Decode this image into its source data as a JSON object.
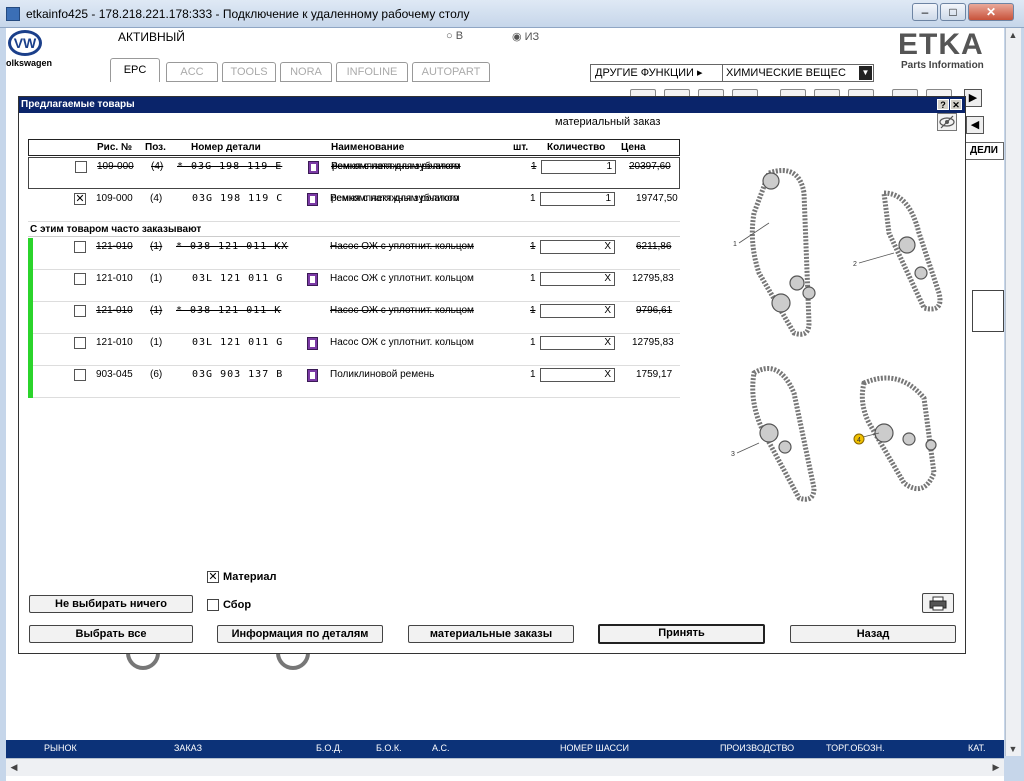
{
  "window": {
    "title": "etkainfo425 - 178.218.221.178:333 - Подключение к удаленному рабочему столу",
    "minimize": "–",
    "maximize": "□",
    "close": "✕"
  },
  "app": {
    "brand": "olkswagen",
    "vw_logo_text": "VW",
    "status": "АКТИВНЫЙ",
    "radio_b": "○ В",
    "radio_iz": "◉ ИЗ",
    "logo": "ETKA",
    "logo_sub": "Parts Information",
    "tabs": [
      "EPC",
      "ACC",
      "TOOLS",
      "NORA",
      "INFOLINE",
      "AUTOPART"
    ],
    "functions_label": "ДРУГИЕ ФУНКЦИИ ▸",
    "functions_value": "ХИМИЧЕСКИЕ ВЕЩЕС",
    "models_button": "ДЕЛИ"
  },
  "statusbar": {
    "market": "РЫНОК",
    "order": "ЗАКАЗ",
    "bod": "Б.О.Д.",
    "bok": "Б.О.К.",
    "ac": "А.С.",
    "chassis": "НОМЕР ШАССИ",
    "production": "ПРОИЗВОДСТВО",
    "trade": "ТОРГ.ОБОЗН.",
    "cat": "КАТ."
  },
  "dialog": {
    "title": "Предлагаемые товары",
    "help_btn": "?",
    "close_btn": "✕",
    "caption": "материальный заказ",
    "columns": {
      "fig": "Рис. №",
      "pos": "Поз.",
      "part": "Номер детали",
      "name": "Наименование",
      "pcs": "шт.",
      "qty": "Количество",
      "price": "Цена"
    },
    "main_rows": [
      {
        "fig": "109-000",
        "pos": "(4)",
        "part": "* 03G 198 119 E",
        "name1": "Ремкомплект для зубчатого",
        "name2": "ремня с натяжным роликом",
        "pcs": "1",
        "qty": "1",
        "price": "20397,60",
        "checked": "",
        "strike": true
      },
      {
        "fig": "109-000",
        "pos": "(4)",
        "part": "03G 198 119 C",
        "name1": "Ремкомплект для зубчатого",
        "name2": "ремня с натяжным роликом",
        "pcs": "1",
        "qty": "1",
        "price": "19747,50",
        "checked": "✕",
        "strike": false
      }
    ],
    "section_label": "С этим товаром часто заказывают",
    "related_rows": [
      {
        "fig": "121-010",
        "pos": "(1)",
        "part": "* 038 121 011 KX",
        "name": "Насос ОЖ с уплотнит. кольцом",
        "pcs": "1",
        "qty": "X",
        "price": "6211,86",
        "strike": true,
        "doc": false
      },
      {
        "fig": "121-010",
        "pos": "(1)",
        "part": "03L 121 011 G",
        "name": "Насос ОЖ с уплотнит. кольцом",
        "pcs": "1",
        "qty": "X",
        "price": "12795,83",
        "strike": false,
        "doc": true
      },
      {
        "fig": "121-010",
        "pos": "(1)",
        "part": "* 038 121 011 K",
        "name": "Насос ОЖ с уплотнит. кольцом",
        "pcs": "1",
        "qty": "X",
        "price": "9796,61",
        "strike": true,
        "doc": false
      },
      {
        "fig": "121-010",
        "pos": "(1)",
        "part": "03L 121 011 G",
        "name": "Насос ОЖ с уплотнит. кольцом",
        "pcs": "1",
        "qty": "X",
        "price": "12795,83",
        "strike": false,
        "doc": true
      },
      {
        "fig": "903-045",
        "pos": "(6)",
        "part": "03G 903 137 B",
        "name": "Поликлиновой ремень",
        "pcs": "1",
        "qty": "X",
        "price": "1759,17",
        "strike": false,
        "doc": true
      }
    ],
    "illustration_labels": [
      "1",
      "2",
      "3",
      "4"
    ],
    "material_check": "✕",
    "material_label": "Материал",
    "collect_check": "",
    "collect_label": "Сбор",
    "btn_select_none": "Не выбирать ничего",
    "btn_select_all": "Выбрать все",
    "btn_part_info": "Информация по деталям",
    "btn_material_orders": "материальные заказы",
    "btn_accept": "Принять",
    "btn_back": "Назад",
    "print_icon": "printer-icon"
  },
  "colors": {
    "dialog_title_bg": "#0a246a",
    "statusbar_bg": "#0c3278",
    "related_marker": "#2bd42b",
    "doc_icon": "#7b3aa5"
  }
}
